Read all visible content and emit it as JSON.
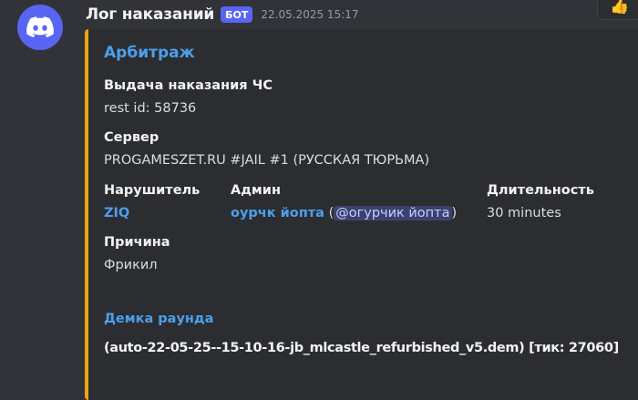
{
  "message": {
    "author": "Лог наказаний",
    "bot_tag": "БОТ",
    "timestamp": "22.05.2025 15:17",
    "avatar_icon": "discord-logo-icon",
    "reaction_icon": "thumbs-up-icon"
  },
  "embed": {
    "accent_color": "#f0a20f",
    "title": "Арбитраж",
    "fields": {
      "punishment": {
        "name": "Выдача наказания ЧС",
        "value": "rest id: 58736"
      },
      "server": {
        "name": "Сервер",
        "value": "PROGAMESZET.RU #JAIL #1 (РУССКАЯ ТЮРЬМА)"
      },
      "offender": {
        "name": "Нарушитель",
        "value": "ZIQ"
      },
      "admin": {
        "name": "Админ",
        "value": "оурчк йопта",
        "open_paren": "(",
        "mention": "@огурчик йопта",
        "close_paren": ")"
      },
      "duration": {
        "name": "Длительность",
        "value": "30 minutes"
      },
      "reason": {
        "name": "Причина",
        "value": "Фрикил"
      }
    },
    "demo": {
      "title": "Демка раунда",
      "value": "(auto-22-05-25--15-10-16-jb_mlcastle_refurbished_v5.dem) [тик: 27060]"
    }
  }
}
